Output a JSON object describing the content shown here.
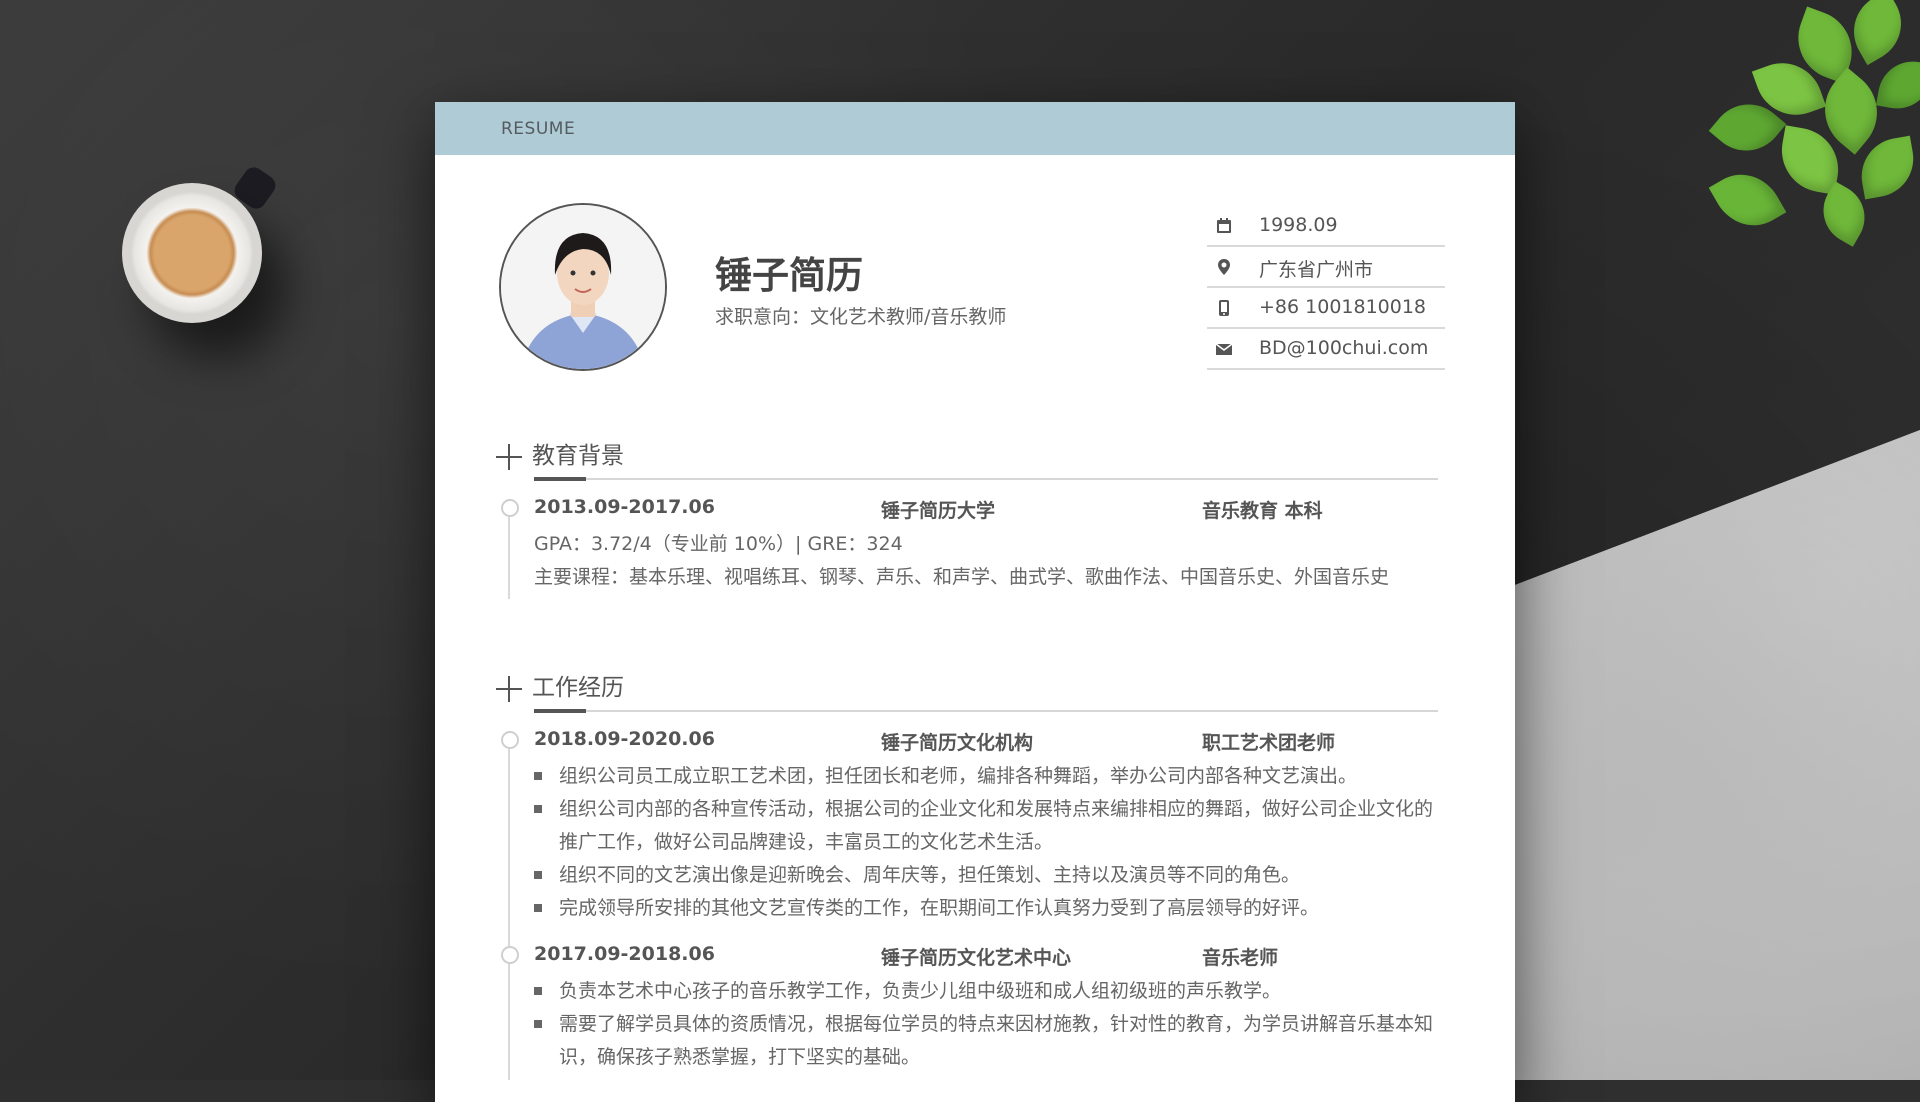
{
  "header": {
    "label": "RESUME"
  },
  "profile": {
    "name": "锤子简历",
    "intent": "求职意向：文化艺术教师/音乐教师"
  },
  "contact": [
    {
      "icon": "calendar-icon",
      "value": "1998.09"
    },
    {
      "icon": "location-pin-icon",
      "value": "广东省广州市"
    },
    {
      "icon": "mobile-phone-icon",
      "value": "+86 1001810018"
    },
    {
      "icon": "envelope-icon",
      "value": "BD@100chui.com"
    }
  ],
  "education": {
    "title": "教育背景",
    "entries": [
      {
        "period": "2013.09-2017.06",
        "school": "锤子简历大学",
        "major": "音乐教育  本科",
        "gpa": "GPA：3.72/4（专业前 10%）| GRE：324",
        "courses": "主要课程：基本乐理、视唱练耳、钢琴、声乐、和声学、曲式学、歌曲作法、中国音乐史、外国音乐史"
      }
    ]
  },
  "work": {
    "title": "工作经历",
    "entries": [
      {
        "period": "2018.09-2020.06",
        "org": "锤子简历文化机构",
        "role": "职工艺术团老师",
        "bullets": [
          [
            "组织公司员工成立职工艺术团，担任团长和老师，编排各种舞蹈，举办公司内部各种文艺演出。"
          ],
          [
            "组织公司内部的各种宣传活动，根据公司的企业文化和发展特点来编排相应的舞蹈，做好公司企业文化的",
            "推广工作，做好公司品牌建设，丰富员工的文化艺术生活。"
          ],
          [
            "组织不同的文艺演出像是迎新晚会、周年庆等，担任策划、主持以及演员等不同的角色。"
          ],
          [
            "完成领导所安排的其他文艺宣传类的工作，在职期间工作认真努力受到了高层领导的好评。"
          ]
        ]
      },
      {
        "period": "2017.09-2018.06",
        "org": "锤子简历文化艺术中心",
        "role": "音乐老师",
        "bullets": [
          [
            "负责本艺术中心孩子的音乐教学工作，负责少儿组中级班和成人组初级班的声乐教学。"
          ],
          [
            "需要了解学员具体的资质情况，根据每位学员的特点来因材施教，针对性的教育，为学员讲解音乐基本知",
            "识，确保孩子熟悉掌握，打下坚实的基础。"
          ]
        ]
      }
    ]
  }
}
